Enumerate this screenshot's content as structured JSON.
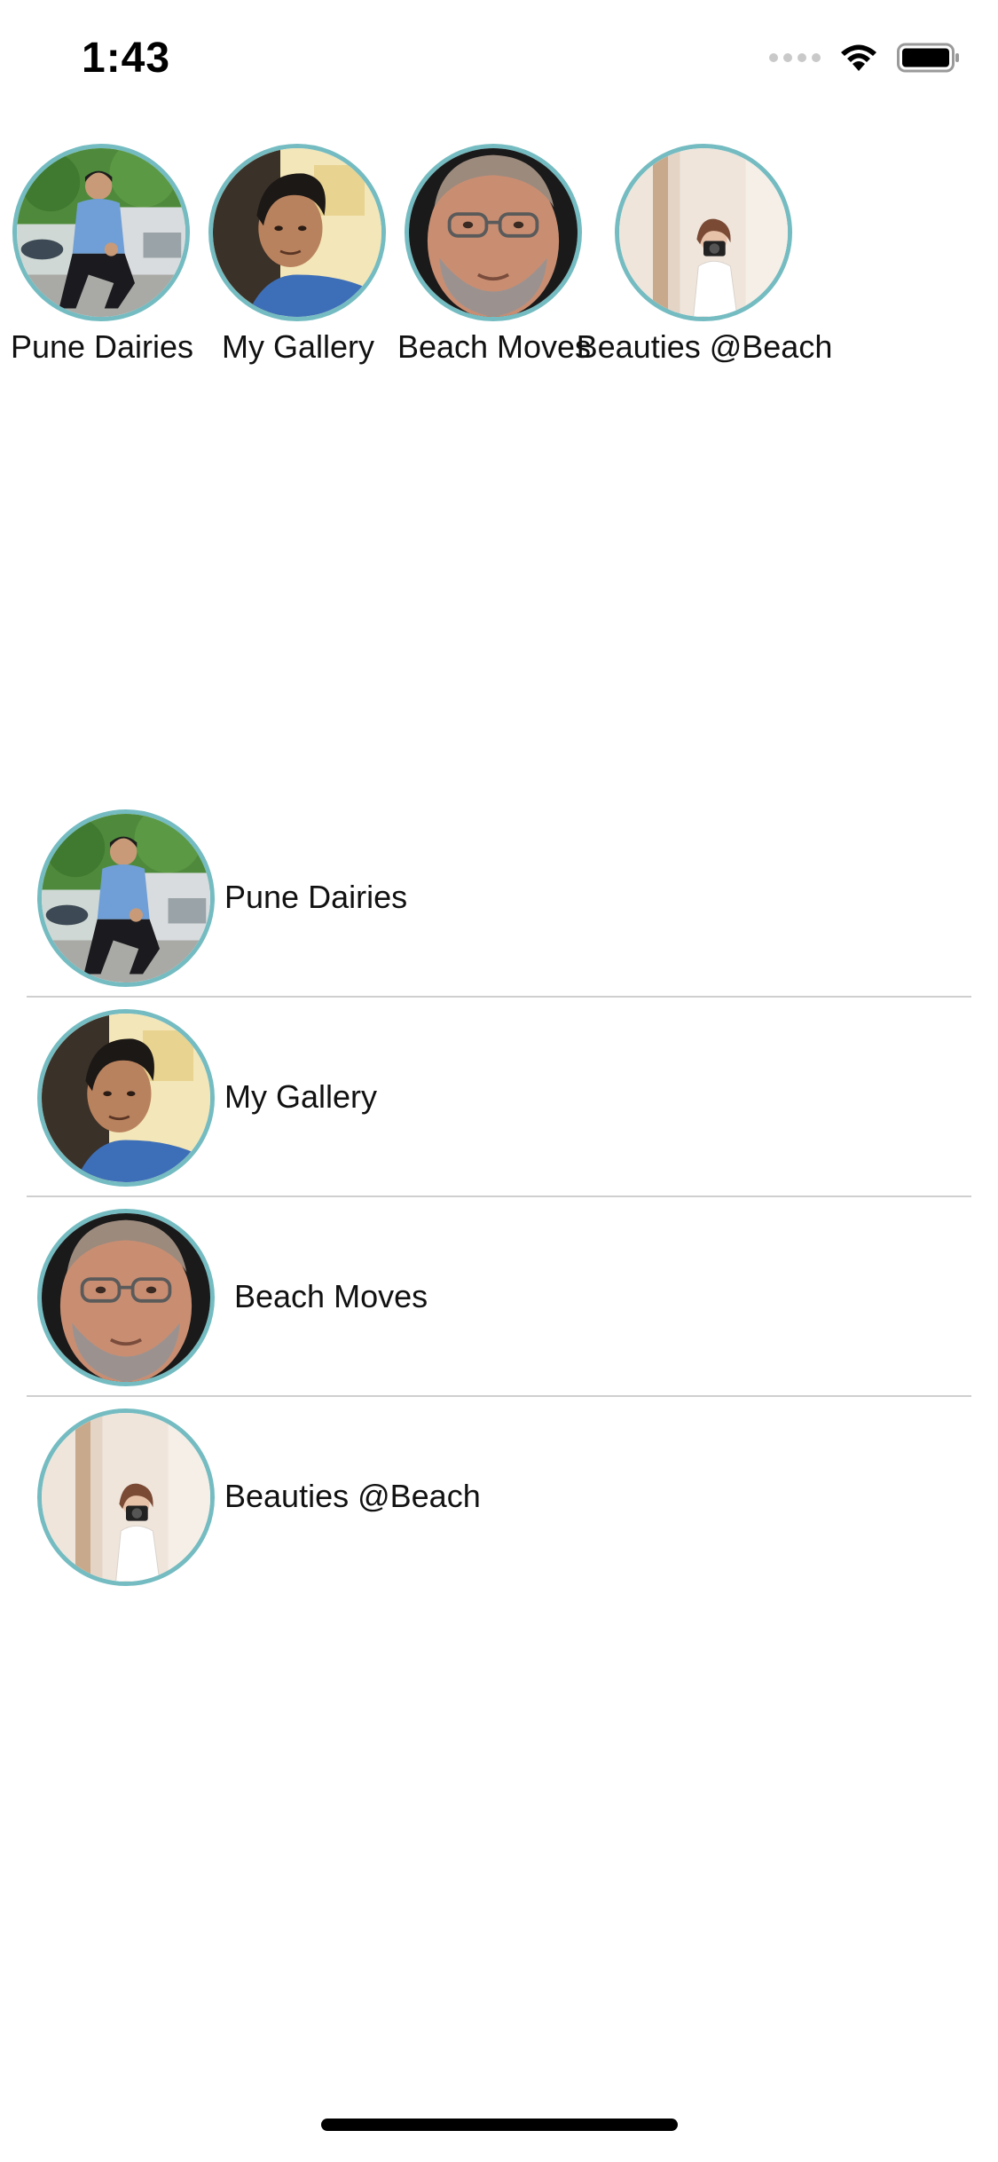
{
  "status_bar": {
    "time": "1:43",
    "wifi_icon": "wifi-icon",
    "battery_icon": "battery-full-icon"
  },
  "albums": [
    {
      "title": "Pune Dairies",
      "thumbnail": "man-sitting-by-car-photo"
    },
    {
      "title": "My Gallery",
      "thumbnail": "man-selfie-photo"
    },
    {
      "title": "Beach Moves",
      "thumbnail": "man-with-glasses-portrait"
    },
    {
      "title": "Beauties @Beach",
      "thumbnail": "woman-with-camera-mirror-photo"
    }
  ],
  "colors": {
    "avatar_border": "#74bcc1",
    "divider": "#cfcfcf",
    "background": "#ffffff",
    "text": "#111111"
  }
}
